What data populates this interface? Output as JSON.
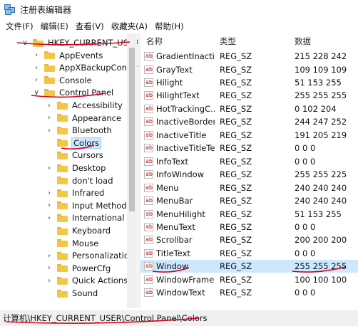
{
  "window": {
    "title": "注册表编辑器"
  },
  "menu": [
    "文件(F)",
    "编辑(E)",
    "查看(V)",
    "收藏夹(A)",
    "帮助(H)"
  ],
  "tree": [
    {
      "label": "HKEY_CURRENT_USER",
      "expander": "open"
    },
    {
      "label": "AppEvents",
      "expander": "closed"
    },
    {
      "label": "AppXBackupConter",
      "expander": "closed"
    },
    {
      "label": "Console",
      "expander": "closed"
    },
    {
      "label": "Control Panel",
      "expander": "open"
    },
    {
      "label": "Accessibility",
      "expander": "closed"
    },
    {
      "label": "Appearance",
      "expander": "closed"
    },
    {
      "label": "Bluetooth",
      "expander": "closed"
    },
    {
      "label": "Colors",
      "expander": "none",
      "selected": true
    },
    {
      "label": "Cursors",
      "expander": "none"
    },
    {
      "label": "Desktop",
      "expander": "closed"
    },
    {
      "label": "don't load",
      "expander": "none"
    },
    {
      "label": "Infrared",
      "expander": "closed"
    },
    {
      "label": "Input Method",
      "expander": "closed"
    },
    {
      "label": "International",
      "expander": "closed"
    },
    {
      "label": "Keyboard",
      "expander": "none"
    },
    {
      "label": "Mouse",
      "expander": "none"
    },
    {
      "label": "Personalization",
      "expander": "closed"
    },
    {
      "label": "PowerCfg",
      "expander": "closed"
    },
    {
      "label": "Quick Actions",
      "expander": "closed"
    },
    {
      "label": "Sound",
      "expander": "none"
    }
  ],
  "columns": {
    "name": "名称",
    "type": "类型",
    "data": "数据"
  },
  "values": [
    {
      "name": "GradientInacti...",
      "type": "REG_SZ",
      "data": "215 228 242"
    },
    {
      "name": "GrayText",
      "type": "REG_SZ",
      "data": "109 109 109"
    },
    {
      "name": "Hilight",
      "type": "REG_SZ",
      "data": "51 153 255"
    },
    {
      "name": "HilightText",
      "type": "REG_SZ",
      "data": "255 255 255"
    },
    {
      "name": "HotTrackingC...",
      "type": "REG_SZ",
      "data": "0 102 204"
    },
    {
      "name": "InactiveBorder",
      "type": "REG_SZ",
      "data": "244 247 252"
    },
    {
      "name": "InactiveTitle",
      "type": "REG_SZ",
      "data": "191 205 219"
    },
    {
      "name": "InactiveTitleText",
      "type": "REG_SZ",
      "data": "0 0 0"
    },
    {
      "name": "InfoText",
      "type": "REG_SZ",
      "data": "0 0 0"
    },
    {
      "name": "InfoWindow",
      "type": "REG_SZ",
      "data": "255 255 225"
    },
    {
      "name": "Menu",
      "type": "REG_SZ",
      "data": "240 240 240"
    },
    {
      "name": "MenuBar",
      "type": "REG_SZ",
      "data": "240 240 240"
    },
    {
      "name": "MenuHilight",
      "type": "REG_SZ",
      "data": "51 153 255"
    },
    {
      "name": "MenuText",
      "type": "REG_SZ",
      "data": "0 0 0"
    },
    {
      "name": "Scrollbar",
      "type": "REG_SZ",
      "data": "200 200 200"
    },
    {
      "name": "TitleText",
      "type": "REG_SZ",
      "data": "0 0 0"
    },
    {
      "name": "Window",
      "type": "REG_SZ",
      "data": "255 255 255",
      "selected": true
    },
    {
      "name": "WindowFrame",
      "type": "REG_SZ",
      "data": "100 100 100"
    },
    {
      "name": "WindowText",
      "type": "REG_SZ",
      "data": "0 0 0"
    }
  ],
  "value_icon_text": "ab",
  "status": {
    "path": "计算机\\HKEY_CURRENT_USER\\Control Panel\\Colors"
  },
  "colors": {
    "annotation": "#d0021b",
    "selection": "#cce8ff",
    "folder": "#f3c648"
  }
}
